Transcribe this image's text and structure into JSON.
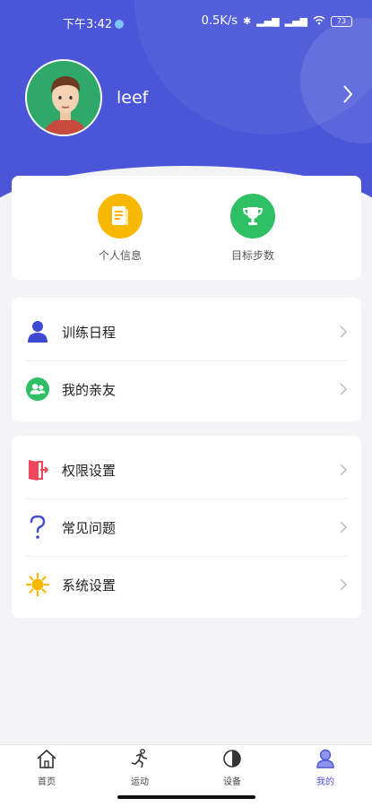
{
  "status_bar": {
    "time": "下午3:42",
    "network_speed": "0.5K/s",
    "battery": "73"
  },
  "profile": {
    "username": "leef"
  },
  "shortcuts": [
    {
      "label": "个人信息",
      "icon": "document-icon",
      "color": "#f9b800"
    },
    {
      "label": "目标步数",
      "icon": "trophy-icon",
      "color": "#2fbf64"
    }
  ],
  "menu_group_1": [
    {
      "label": "训练日程",
      "icon": "person-icon"
    },
    {
      "label": "我的亲友",
      "icon": "friends-icon"
    }
  ],
  "menu_group_2": [
    {
      "label": "权限设置",
      "icon": "exit-door-icon"
    },
    {
      "label": "常见问题",
      "icon": "question-icon"
    },
    {
      "label": "系统设置",
      "icon": "sun-gear-icon"
    }
  ],
  "tabs": [
    {
      "label": "首页",
      "icon": "home-icon",
      "active": false
    },
    {
      "label": "运动",
      "icon": "running-icon",
      "active": false
    },
    {
      "label": "设备",
      "icon": "device-icon",
      "active": false
    },
    {
      "label": "我的",
      "icon": "user-icon",
      "active": true
    }
  ],
  "colors": {
    "accent": "#4a55d8",
    "yellow": "#f9b800",
    "green": "#2fbf64",
    "red": "#f0485a"
  }
}
